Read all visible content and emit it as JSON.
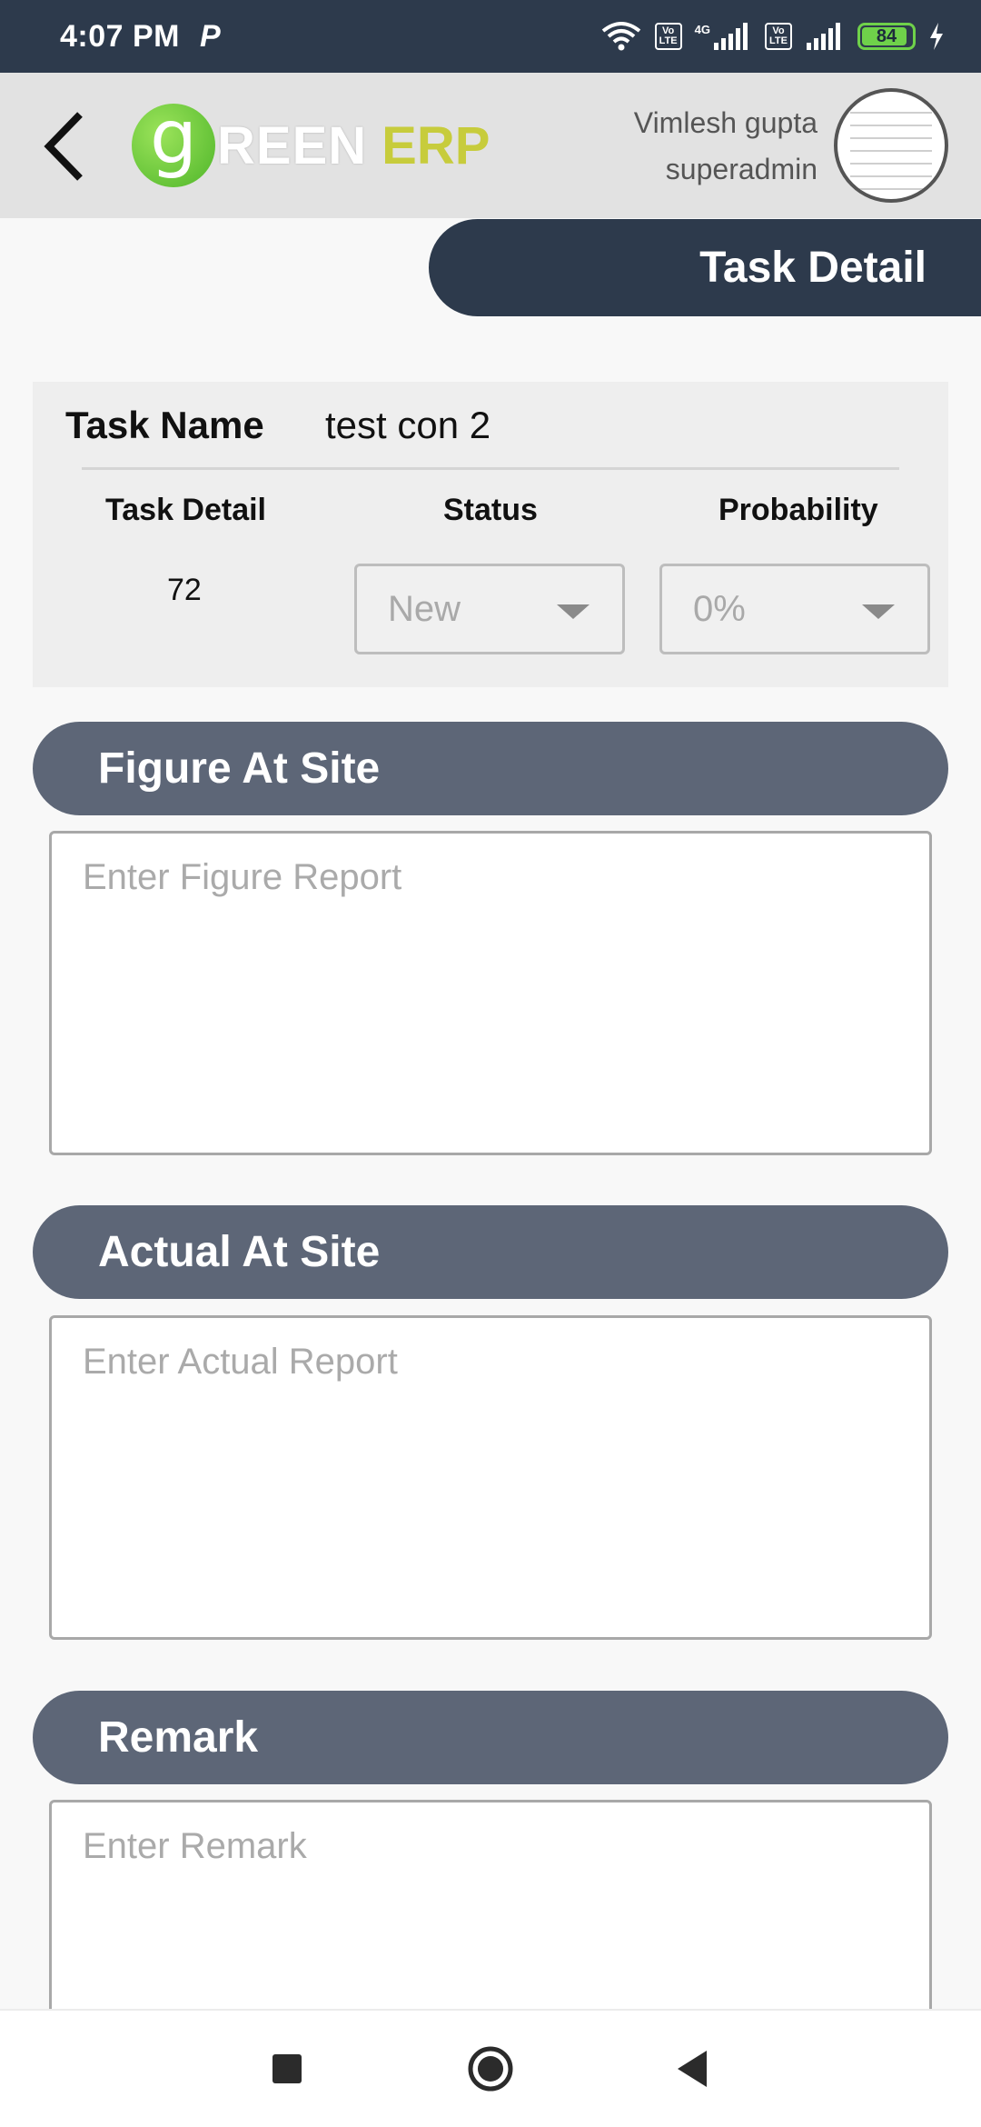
{
  "status_bar": {
    "time": "4:07 PM",
    "p_icon": "P",
    "lte1": "Vo\nLTE",
    "net_label": "4G",
    "lte2": "Vo\nLTE",
    "battery": "84",
    "icons": [
      "wifi-icon",
      "signal-icon",
      "battery-icon",
      "charging-icon"
    ]
  },
  "header": {
    "logo_letter": "g",
    "logo_word1": "REEN",
    "logo_word2": "ERP",
    "user_name": "Vimlesh gupta",
    "user_role": "superadmin"
  },
  "page_title": "Task Detail",
  "task": {
    "name_label": "Task Name",
    "name_value": "test con 2",
    "detail_label": "Task Detail",
    "detail_value": "72",
    "status_label": "Status",
    "status_value": "New",
    "probability_label": "Probability",
    "probability_value": "0%"
  },
  "sections": {
    "figure": {
      "title": "Figure At Site",
      "placeholder": "Enter Figure Report"
    },
    "actual": {
      "title": "Actual At Site",
      "placeholder": "Enter Actual Report"
    },
    "remark": {
      "title": "Remark",
      "placeholder": "Enter Remark"
    }
  },
  "colors": {
    "dark": "#2d3a4c",
    "section": "#5d6677",
    "logo_green": "#4fb62a",
    "logo_olive": "#c7cc3c"
  }
}
